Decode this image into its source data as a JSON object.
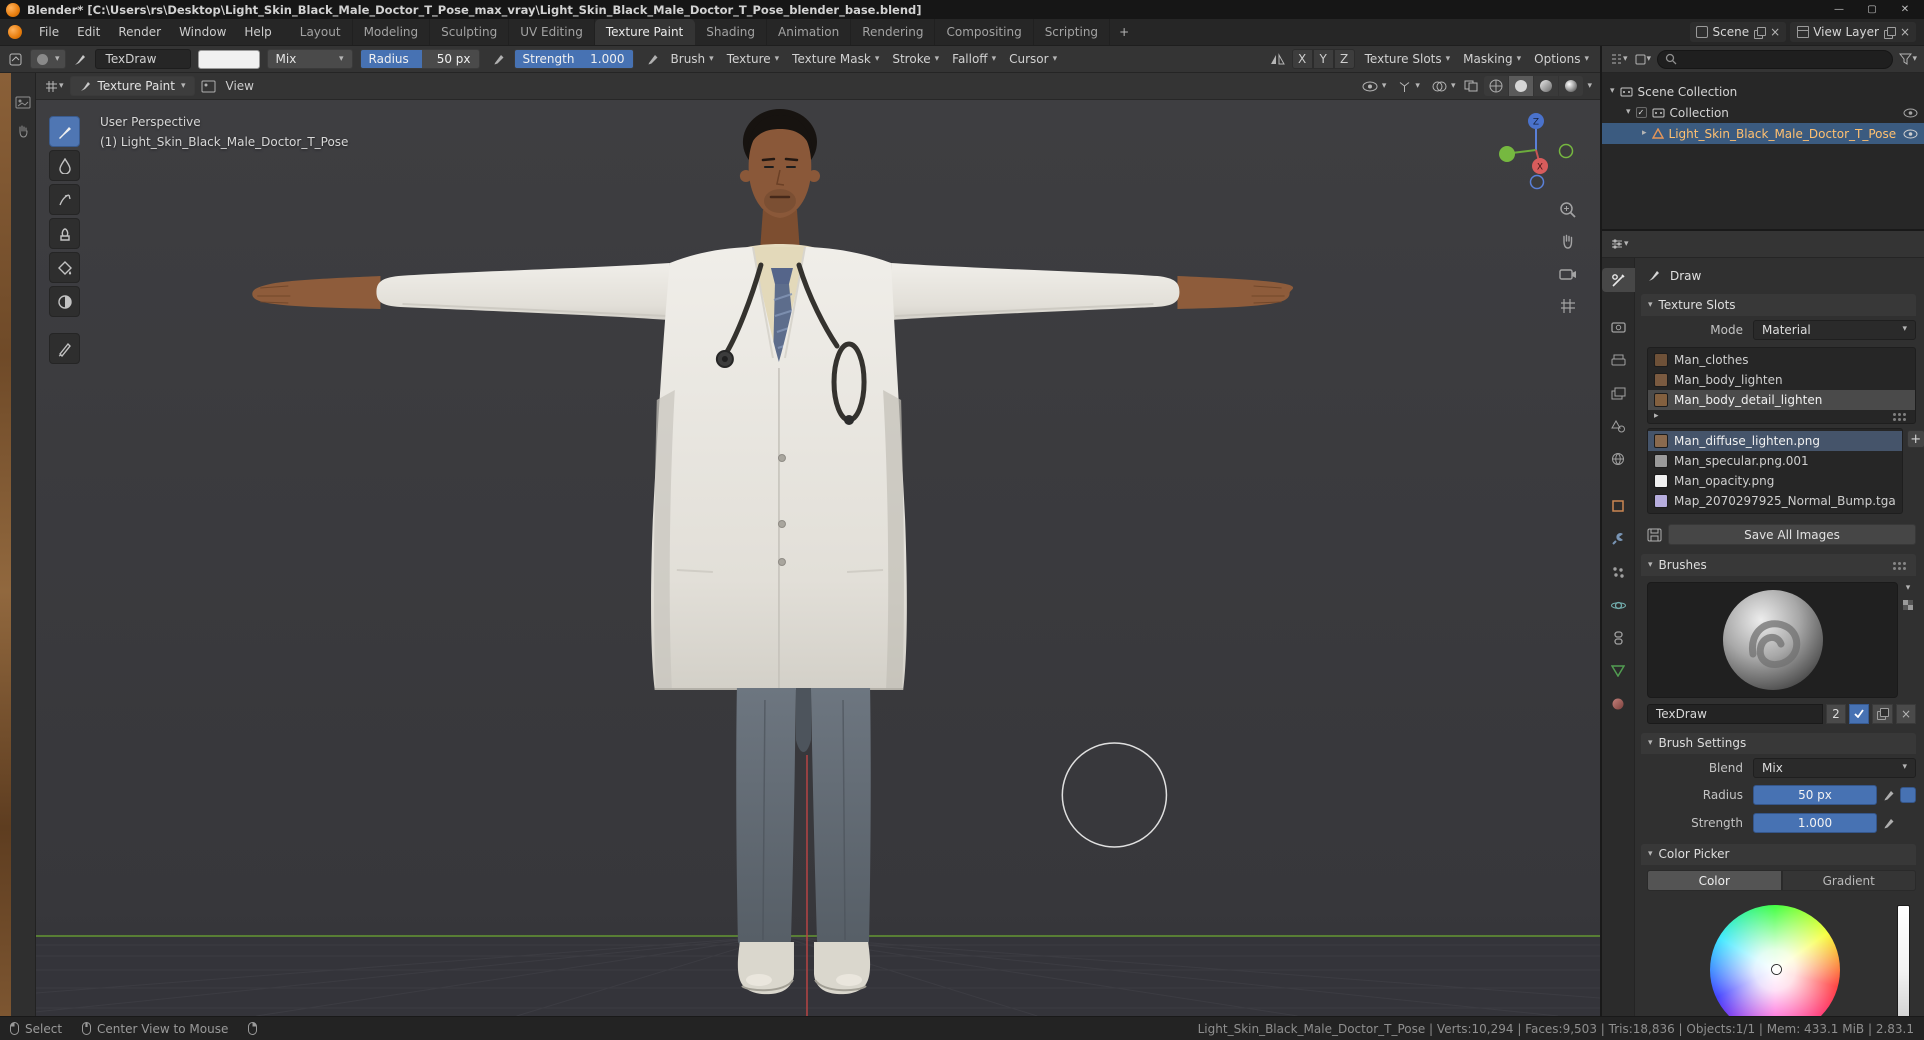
{
  "window": {
    "title": "Blender* [C:\\Users\\rs\\Desktop\\Light_Skin_Black_Male_Doctor_T_Pose_max_vray\\Light_Skin_Black_Male_Doctor_T_Pose_blender_base.blend]"
  },
  "topbar": {
    "menus": [
      "File",
      "Edit",
      "Render",
      "Window",
      "Help"
    ],
    "workspaces": [
      "Layout",
      "Modeling",
      "Sculpting",
      "UV Editing",
      "Texture Paint",
      "Shading",
      "Animation",
      "Rendering",
      "Compositing",
      "Scripting"
    ],
    "add_workspace": "+",
    "scene_label": "Scene",
    "view_layer_label": "View Layer"
  },
  "tool_settings": {
    "brush_name": "TexDraw",
    "blend_mode": "Mix",
    "radius_label": "Radius",
    "radius_value": "50 px",
    "strength_label": "Strength",
    "strength_value": "1.000",
    "popovers": [
      "Brush",
      "Texture",
      "Texture Mask",
      "Stroke",
      "Falloff",
      "Cursor"
    ],
    "mirror_axes": [
      "X",
      "Y",
      "Z"
    ],
    "right_popovers": [
      "Texture Slots",
      "Masking",
      "Options"
    ]
  },
  "viewport": {
    "mode": "Texture Paint",
    "view_menu": "View",
    "overlay_line1": "User Perspective",
    "overlay_line2": "(1) Light_Skin_Black_Male_Doctor_T_Pose",
    "gizmo": {
      "x": "X",
      "z": "Z"
    }
  },
  "outliner": {
    "rows": [
      {
        "label": "Scene Collection"
      },
      {
        "label": "Collection"
      },
      {
        "label": "Light_Skin_Black_Male_Doctor_T_Pose"
      }
    ]
  },
  "properties": {
    "active_tool": "Draw",
    "texture_slots": {
      "title": "Texture Slots",
      "mode_label": "Mode",
      "mode_value": "Material",
      "slots": [
        "Man_clothes",
        "Man_body_lighten",
        "Man_body_detail_lighten"
      ],
      "textures": [
        {
          "name": "Man_diffuse_lighten.png",
          "thumb": "#8a6a4e"
        },
        {
          "name": "Man_specular.png.001",
          "thumb": "#9a9a9a"
        },
        {
          "name": "Man_opacity.png",
          "thumb": "#f2f2f2"
        },
        {
          "name": "Map_2070297925_Normal_Bump.tga",
          "thumb": "#b7aede"
        }
      ],
      "save_button": "Save All Images"
    },
    "brushes": {
      "title": "Brushes",
      "brush_name": "TexDraw",
      "users": "2"
    },
    "brush_settings": {
      "title": "Brush Settings",
      "blend_label": "Blend",
      "blend_value": "Mix",
      "radius_label": "Radius",
      "radius_value": "50 px",
      "strength_label": "Strength",
      "strength_value": "1.000"
    },
    "color_picker": {
      "title": "Color Picker",
      "tabs": [
        "Color",
        "Gradient"
      ]
    }
  },
  "statusbar": {
    "select": "Select",
    "center_view": "Center View to Mouse",
    "stats": "Light_Skin_Black_Male_Doctor_T_Pose | Verts:10,294 | Faces:9,503 | Tris:18,836 | Objects:1/1 | Mem: 433.1 MiB | 2.83.1"
  },
  "colors": {
    "accent_blue": "#4772b3",
    "axis_green": "#6aa133",
    "axis_red": "#bc4545",
    "selected_row": "#3b5b80"
  }
}
